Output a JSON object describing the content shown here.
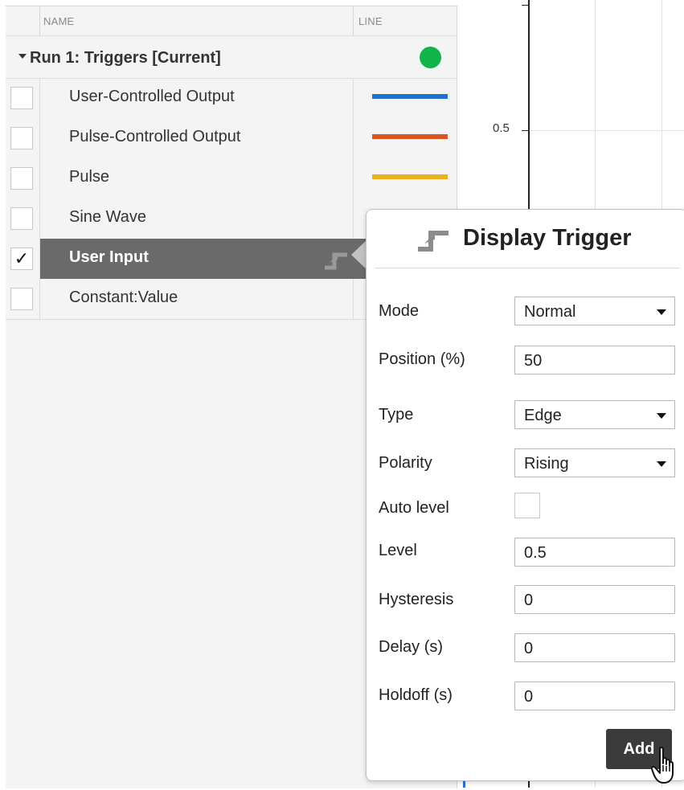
{
  "table": {
    "headers": {
      "name": "NAME",
      "line": "LINE"
    },
    "run": {
      "label": "Run 1: Triggers [Current]",
      "status_color": "#11b34a"
    },
    "signals": [
      {
        "label": "User-Controlled Output",
        "checked": false,
        "line_color": "#1f71c9",
        "selected": false
      },
      {
        "label": "Pulse-Controlled Output",
        "checked": false,
        "line_color": "#d9541e",
        "selected": false
      },
      {
        "label": "Pulse",
        "checked": false,
        "line_color": "#ecb01f",
        "selected": false
      },
      {
        "label": "Sine Wave",
        "checked": false,
        "line_color": "",
        "selected": false
      },
      {
        "label": "User Input",
        "checked": true,
        "check_glyph": "✓",
        "line_color": "",
        "selected": true,
        "icon": "trigger-icon"
      },
      {
        "label": "Constant:Value",
        "checked": false,
        "line_color": "",
        "selected": false
      }
    ]
  },
  "plot": {
    "tick_labels": [
      "0.5"
    ],
    "axis_color": "#222222"
  },
  "trigger_popup": {
    "title": "Display Trigger",
    "title_icon": "trigger-icon",
    "fields": {
      "mode": {
        "label": "Mode",
        "value": "Normal"
      },
      "position": {
        "label": "Position (%)",
        "value": "50"
      },
      "type": {
        "label": "Type",
        "value": "Edge"
      },
      "polarity": {
        "label": "Polarity",
        "value": "Rising"
      },
      "auto_level": {
        "label": "Auto level",
        "checked": false
      },
      "level": {
        "label": "Level",
        "value": "0.5"
      },
      "hysteresis": {
        "label": "Hysteresis",
        "value": "0"
      },
      "delay": {
        "label": "Delay (s)",
        "value": "0"
      },
      "holdoff": {
        "label": "Holdoff (s)",
        "value": "0"
      }
    },
    "add_button": "Add",
    "cursor_icon": "hand-pointer-icon"
  }
}
